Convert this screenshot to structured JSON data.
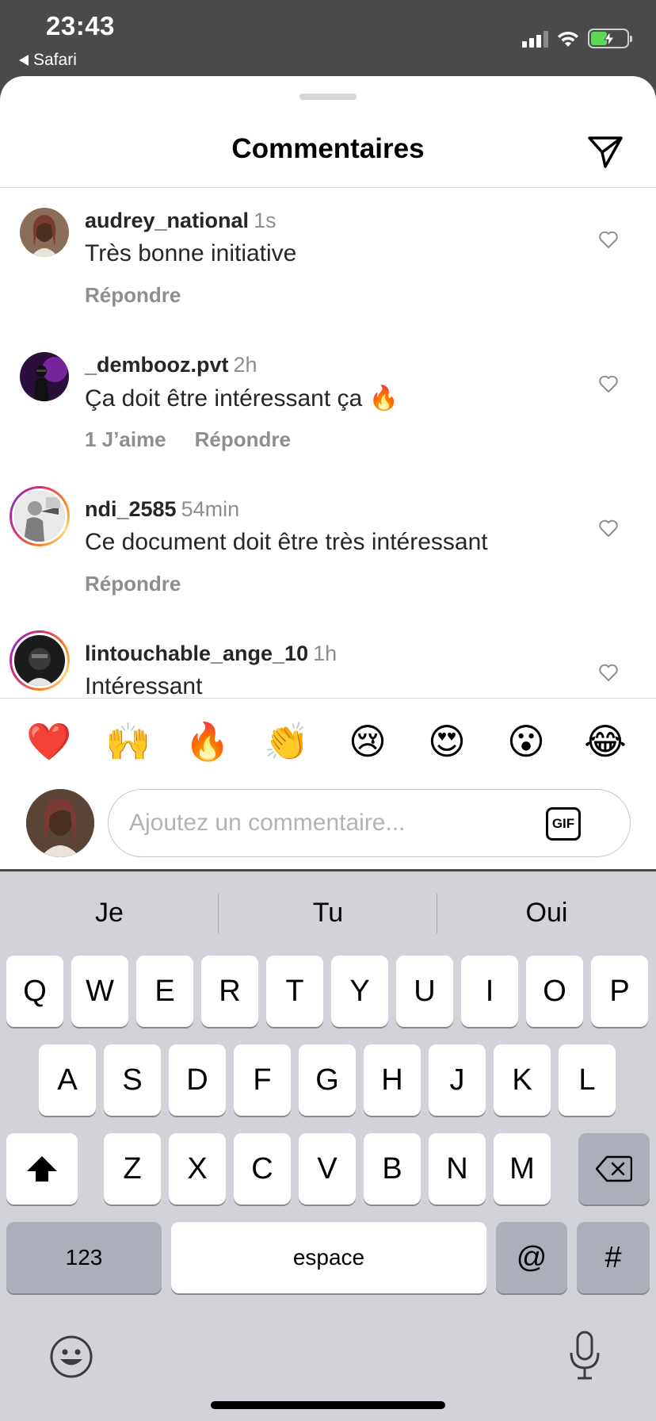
{
  "status_bar": {
    "time": "23:43",
    "back_app": "Safari"
  },
  "sheet": {
    "title": "Commentaires",
    "send_icon": "paper-plane-icon"
  },
  "comments": [
    {
      "username": "audrey_national",
      "time": "1s",
      "text": "Très bonne initiative",
      "likes_label": "",
      "reply_label": "Répondre"
    },
    {
      "username": "_dembooz.pvt",
      "time": "2h",
      "text": "Ça doit être intéressant ça 🔥",
      "likes_label": "1 J’aime",
      "reply_label": "Répondre"
    },
    {
      "username": "ndi_2585",
      "time": "54min",
      "text": "Ce document doit être très intéressant",
      "likes_label": "",
      "reply_label": "Répondre"
    },
    {
      "username": "lintouchable_ange_10",
      "time": "1h",
      "text": "Intéressant",
      "likes_label": "",
      "reply_label": ""
    }
  ],
  "emoji_reactions": [
    "❤️",
    "🙌",
    "🔥",
    "👏",
    "😢",
    "😍",
    "😮",
    "😂"
  ],
  "comment_input": {
    "placeholder": "Ajoutez un commentaire...",
    "value": "",
    "gif_label": "GIF"
  },
  "keyboard": {
    "suggestions": [
      "Je",
      "Tu",
      "Oui"
    ],
    "row1": [
      "Q",
      "W",
      "E",
      "R",
      "T",
      "Y",
      "U",
      "I",
      "O",
      "P"
    ],
    "row2": [
      "A",
      "S",
      "D",
      "F",
      "G",
      "H",
      "J",
      "K",
      "L"
    ],
    "row3": [
      "Z",
      "X",
      "C",
      "V",
      "B",
      "N",
      "M"
    ],
    "numbers_label": "123",
    "space_label": "espace",
    "at_label": "@",
    "hash_label": "#"
  },
  "colors": {
    "status_bar_bg": "#4a4a4a",
    "secondary_text": "#8e8e8e",
    "keyboard_bg": "#d1d3d9",
    "dark_key": "#abafba"
  }
}
